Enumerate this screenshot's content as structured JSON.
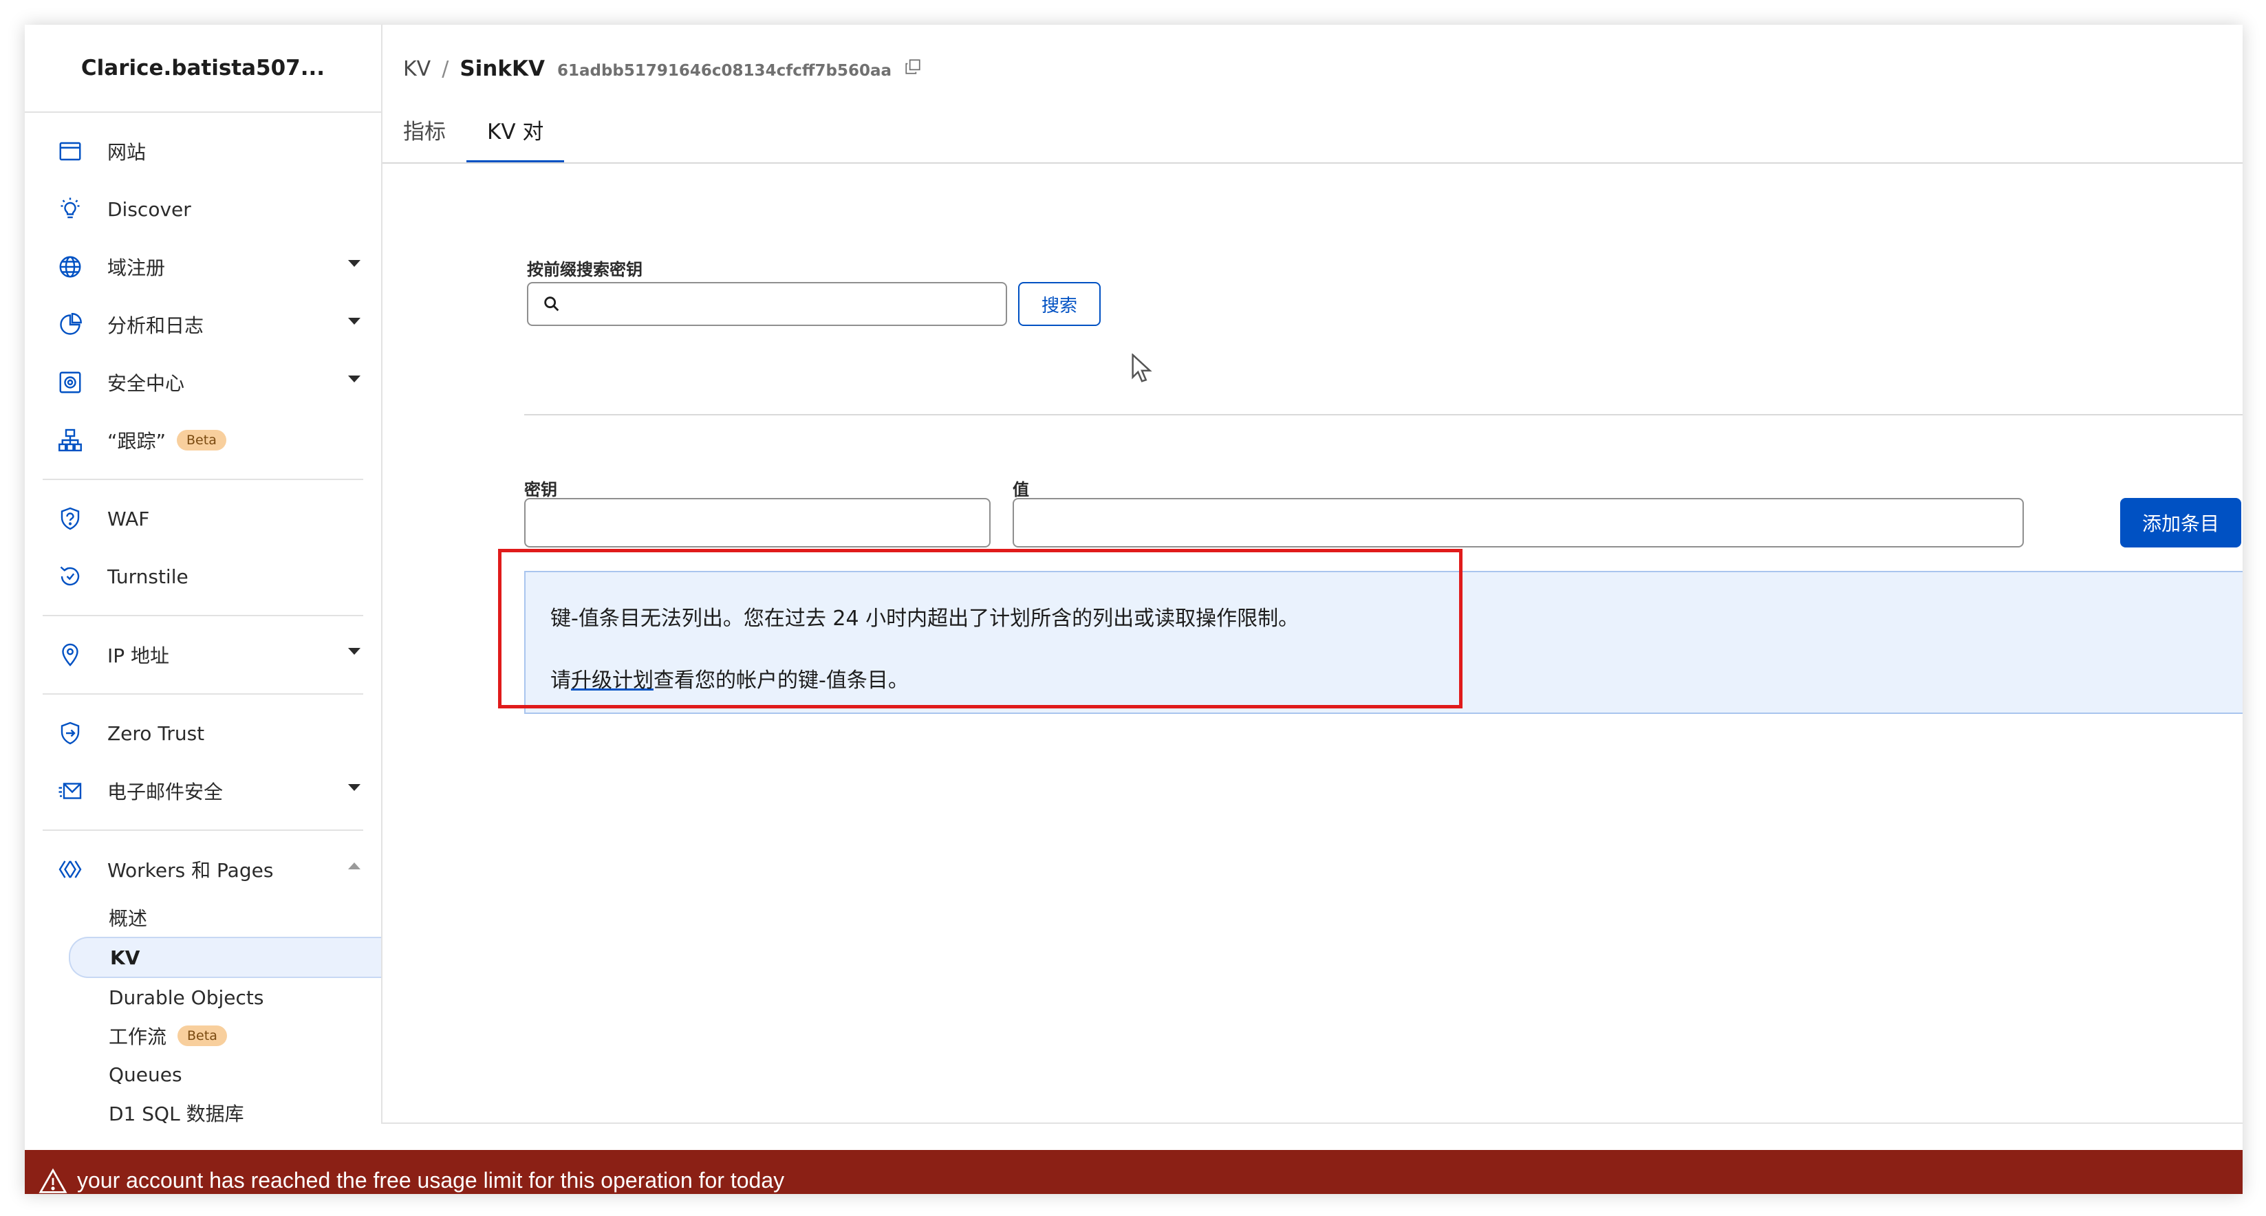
{
  "account": {
    "name": "Clarice.batista507..."
  },
  "sidebar": {
    "groups": [
      [
        {
          "label": "网站",
          "icon": "window-icon"
        },
        {
          "label": "Discover",
          "icon": "lightbulb-icon"
        },
        {
          "label": "域注册",
          "icon": "globe-icon",
          "expandable": true
        },
        {
          "label": "分析和日志",
          "icon": "pie-chart-icon",
          "expandable": true
        },
        {
          "label": "安全中心",
          "icon": "shield-gear-icon",
          "expandable": true
        },
        {
          "label": "“跟踪”",
          "icon": "sitemap-icon",
          "badge": "Beta"
        }
      ],
      [
        {
          "label": "WAF",
          "icon": "waf-shield-icon"
        },
        {
          "label": "Turnstile",
          "icon": "refresh-icon"
        }
      ],
      [
        {
          "label": "IP 地址",
          "icon": "location-pin-icon",
          "expandable": true
        }
      ],
      [
        {
          "label": "Zero Trust",
          "icon": "zero-trust-icon"
        },
        {
          "label": "电子邮件安全",
          "icon": "email-icon",
          "expandable": true
        }
      ]
    ],
    "workers": {
      "label": "Workers 和 Pages",
      "icon": "workers-icon",
      "sub_items": [
        {
          "label": "概述"
        },
        {
          "label": "KV",
          "active": true
        },
        {
          "label": "Durable Objects"
        },
        {
          "label": "工作流",
          "badge": "Beta"
        },
        {
          "label": "Queues"
        },
        {
          "label": "D1 SQL 数据库"
        }
      ]
    }
  },
  "breadcrumb": {
    "root": "KV",
    "separator": "/",
    "title": "SinkKV",
    "namespace_id": "61adbb51791646c08134cfcff7b560aa"
  },
  "tabs": [
    {
      "label": "指标",
      "active": false
    },
    {
      "label": "KV 对",
      "active": true
    }
  ],
  "search": {
    "label": "按前缀搜索密钥",
    "value": "",
    "button": "搜索"
  },
  "entry_form": {
    "key_label": "密钥",
    "value_label": "值",
    "add_button": "添加条目"
  },
  "notice": {
    "line1": "键-值条目无法列出。您在过去 24 小时内超出了计划所含的列出或读取操作限制。",
    "line2_prefix": "请",
    "line2_link": "升级计划",
    "line2_suffix": "查看您的帐户的键-值条目。"
  },
  "banner": {
    "message": "your account has reached the free usage limit for this operation for today"
  },
  "colors": {
    "accent": "#0051c3",
    "banner_bg": "#8b2015",
    "highlight": "#e01b1b",
    "notice_bg": "#eaf2fd",
    "badge_bg": "#f8cf9d"
  }
}
